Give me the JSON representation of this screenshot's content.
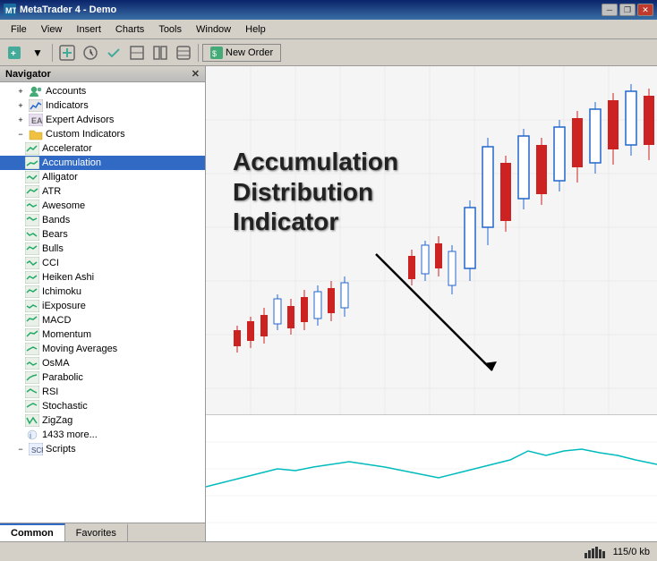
{
  "titleBar": {
    "title": "MetaTrader 4 - Demo",
    "iconLabel": "MT",
    "controls": {
      "minimize": "─",
      "restore": "❐",
      "close": "✕"
    }
  },
  "menuBar": {
    "items": [
      "File",
      "View",
      "Insert",
      "Charts",
      "Tools",
      "Window",
      "Help"
    ]
  },
  "toolbar": {
    "newOrderLabel": "New Order",
    "buttons": [
      "↩",
      "↪",
      "⊞",
      "⊕",
      "↑↓",
      "□",
      "▤",
      "⊞"
    ]
  },
  "navigator": {
    "title": "Navigator",
    "closeIcon": "✕",
    "tree": {
      "accounts": "Accounts",
      "indicators": "Indicators",
      "expertAdvisors": "Expert Advisors",
      "customIndicators": "Custom Indicators",
      "items": [
        "Accelerator",
        "Accumulation",
        "Alligator",
        "ATR",
        "Awesome",
        "Bands",
        "Bears",
        "Bulls",
        "CCI",
        "Heiken Ashi",
        "Ichimoku",
        "iExposure",
        "MACD",
        "Momentum",
        "Moving Averages",
        "OsMA",
        "Parabolic",
        "RSI",
        "Stochastic",
        "ZigZag",
        "1433 more...",
        "Scripts"
      ]
    },
    "tabs": {
      "common": "Common",
      "favorites": "Favorites"
    }
  },
  "chart": {
    "annotation": {
      "line1": "Accumulation",
      "line2": "Distribution",
      "line3": "Indicator"
    }
  },
  "statusBar": {
    "left": "",
    "indicator": "115/0 kb"
  },
  "colors": {
    "bullCandle": "#2266cc",
    "bearCandle": "#cc2222",
    "indicatorLine": "#00cccc",
    "chartBg": "#f5f5f5",
    "indicatorBg": "#ffffff"
  }
}
